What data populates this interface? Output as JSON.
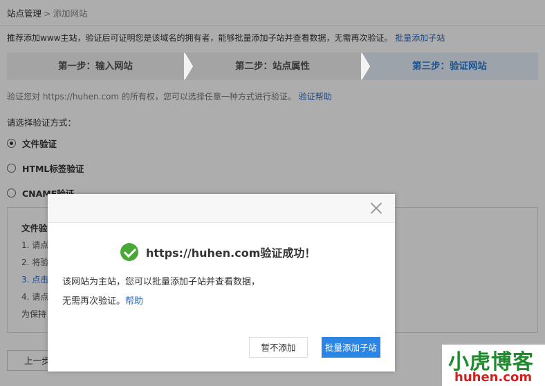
{
  "breadcrumb": {
    "root": "站点管理",
    "sep": ">",
    "current": "添加网站"
  },
  "notice": {
    "text": "推荐添加www主站，验证后可证明您是该域名的拥有者，能够批量添加子站并查看数据，无需再次验证。",
    "link": "批量添加子站"
  },
  "steps": [
    {
      "label": "第一步：输入网站",
      "active": false
    },
    {
      "label": "第二步：站点属性",
      "active": false
    },
    {
      "label": "第三步：验证网站",
      "active": true
    }
  ],
  "verify": {
    "desc": "验证您对 https://huhen.com 的所有权，您可以选择任意一种方式进行验证。",
    "help_link": "验证帮助"
  },
  "choose_label": "请选择验证方式：",
  "methods": [
    {
      "label": "文件验证",
      "checked": true
    },
    {
      "label": "HTML标签验证",
      "checked": false
    },
    {
      "label": "CNAME验证",
      "checked": false
    }
  ],
  "file_box": {
    "title": "文件验",
    "lines": [
      "1. 请点",
      "2. 将验",
      "3. 点击",
      "4. 请点",
      "为保持"
    ]
  },
  "prev_button": "上一步",
  "dialog": {
    "success": "https://huhen.com验证成功！",
    "message_line1": "该网站为主站，您可以批量添加子站并查看数据，",
    "message_line2": "无需再次验证。",
    "help_link": "帮助",
    "cancel_button": "暂不添加",
    "confirm_button": "批量添加子站"
  },
  "watermark": {
    "top": "小虎博客",
    "bottom": "huhen.com"
  },
  "colors": {
    "accent": "#2b85e4",
    "link": "#2b6cc4",
    "success": "#49a836",
    "step_active": "#2b7bd4"
  }
}
